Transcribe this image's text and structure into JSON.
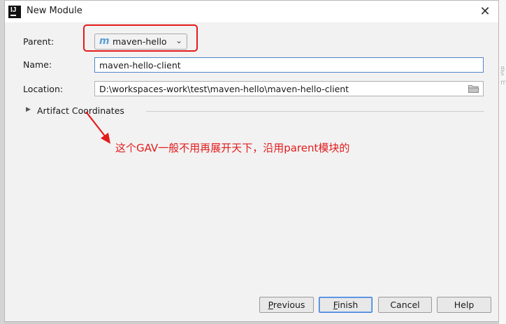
{
  "window": {
    "title": "New Module",
    "app_icon_glyph": "IJ",
    "close_glyph": "✕"
  },
  "form": {
    "parent_label": "Parent:",
    "parent_value": "maven-hello",
    "parent_icon_glyph": "m",
    "name_label": "Name:",
    "name_value": "maven-hello-client",
    "location_label": "Location:",
    "location_value": "D:\\workspaces-work\\test\\maven-hello\\maven-hello-client",
    "artifact_section": "Artifact Coordinates"
  },
  "annotation": {
    "text": "这个GAV一般不用再展开天下，沿用parent模块的",
    "color": "#e31b1b"
  },
  "buttons": {
    "previous_mnemonic": "P",
    "previous_rest": "revious",
    "finish_mnemonic": "F",
    "finish_rest": "inish",
    "cancel": "Cancel",
    "help": "Help"
  },
  "background": {
    "ghost_1": "8",
    "ghost_2": "s",
    "ghost_3": "m"
  },
  "colors": {
    "highlight_border": "#e41a1a",
    "focused_input_border": "#4f86c6",
    "maven_icon": "#5a9fd6"
  }
}
